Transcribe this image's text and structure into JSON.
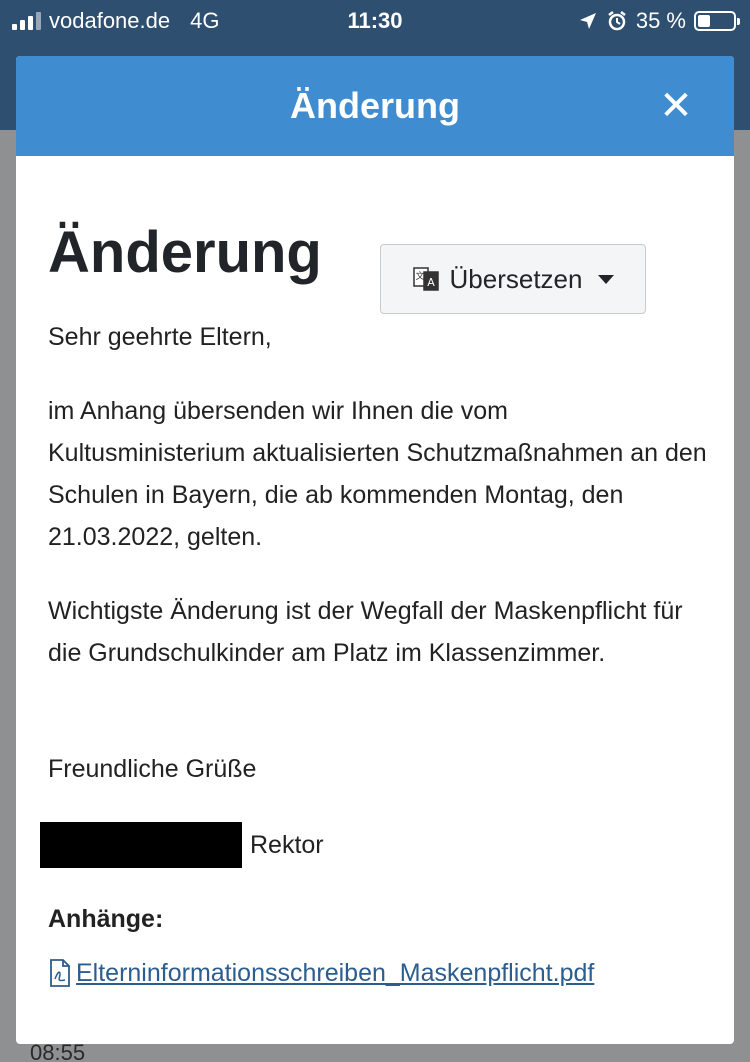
{
  "status_bar": {
    "carrier": "vodafone.de",
    "network": "4G",
    "time": "11:30",
    "battery": "35 %",
    "battery_level": 0.35
  },
  "background": {
    "time_label": "08:55"
  },
  "modal": {
    "header_title": "Änderung",
    "close_label": "✕",
    "title": "Änderung",
    "translate_label": "Übersetzen",
    "greeting": "Sehr geehrte Eltern,",
    "paragraph1": "im Anhang übersenden wir Ihnen die vom Kultusministerium aktualisierten Schutzmaßnahmen an den Schulen in Bayern, die ab kommenden Montag, den 21.03.2022, gelten.",
    "paragraph2": "Wichtigste Änderung ist der Wegfall der Maskenpflicht für die Grundschulkinder am Platz im Klassenzimmer.",
    "closing": "Freundliche Grüße",
    "signature_role": "Rektor",
    "attachments_title": "Anhänge:",
    "attachment_file": "Elterninformationsschreiben_Maskenpflicht.pdf"
  },
  "colors": {
    "header_blue": "#3f8dd0",
    "link_blue": "#2c5d8f"
  }
}
